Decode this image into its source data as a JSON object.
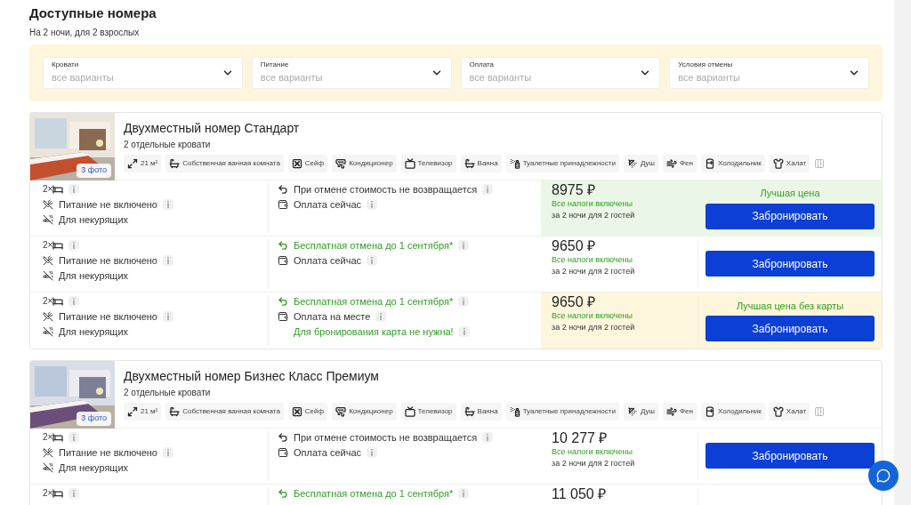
{
  "header": {
    "title": "Доступные номера",
    "subtitle": "На 2 ночи, для 2 взрослых"
  },
  "filters": [
    {
      "label": "Кровати",
      "placeholder": "все варианты"
    },
    {
      "label": "Питание",
      "placeholder": "все варианты"
    },
    {
      "label": "Оплата",
      "placeholder": "все варианты"
    },
    {
      "label": "Условия отмены",
      "placeholder": "все варианты"
    }
  ],
  "rooms": [
    {
      "title": "Двухместный номер Стандарт",
      "beds": "2 отдельные кровати",
      "photos": "3 фото",
      "amenities": [
        "21 м²",
        "Собственная ванная комната",
        "Сейф",
        "Кондиционер",
        "Телевизор",
        "Ванна",
        "Туалетные принадлежности",
        "Душ",
        "Фен",
        "Холодильник",
        "Халат"
      ],
      "offers": [
        {
          "bed_count": "2×",
          "meal": "Питание не включено",
          "smoking": "Для некурящих",
          "cancel": "При отмене стоимость не возвращается",
          "cancel_free": false,
          "payment": "Оплата сейчас",
          "price": "8975 ₽",
          "taxes": "Все налоги включены",
          "nights": "за 2 ночи для 2 гостей",
          "badge": "Лучшая цена",
          "color": "#eaf7e6",
          "button": "Забронировать"
        },
        {
          "bed_count": "2×",
          "meal": "Питание не включено",
          "smoking": "Для некурящих",
          "cancel": "Бесплатная отмена до 1 сентября*",
          "cancel_free": true,
          "payment": "Оплата сейчас",
          "price": "9650 ₽",
          "taxes": "Все налоги включены",
          "nights": "за 2 ночи для 2 гостей",
          "button": "Забронировать"
        },
        {
          "bed_count": "2×",
          "meal": "Питание не включено",
          "smoking": "Для некурящих",
          "cancel": "Бесплатная отмена до 1 сентября*",
          "cancel_free": true,
          "payment": "Оплата на месте",
          "note": "Для бронирования карта не нужна!",
          "price": "9650 ₽",
          "taxes": "Все налоги включены",
          "nights": "за 2 ночи для 2 гостей",
          "badge": "Лучшая цена без карты",
          "color": "#fdf6dc",
          "button": "Забронировать"
        }
      ]
    },
    {
      "title": "Двухместный номер Бизнес Класс Премиум",
      "beds": "2 отдельные кровати",
      "photos": "3 фото",
      "amenities": [
        "21 м²",
        "Собственная ванная комната",
        "Сейф",
        "Кондиционер",
        "Телевизор",
        "Ванна",
        "Туалетные принадлежности",
        "Душ",
        "Фен",
        "Холодильник",
        "Халат"
      ],
      "offers": [
        {
          "bed_count": "2×",
          "meal": "Питание не включено",
          "smoking": "Для некурящих",
          "cancel": "При отмене стоимость не возвращается",
          "cancel_free": false,
          "payment": "Оплата сейчас",
          "price": "10 277 ₽",
          "taxes": "Все налоги включены",
          "nights": "за 2 ночи для 2 гостей",
          "button": "Забронировать"
        },
        {
          "bed_count": "2×",
          "cancel": "Бесплатная отмена до 1 сентября*",
          "cancel_free": true,
          "price": "11 050 ₽"
        }
      ]
    }
  ]
}
